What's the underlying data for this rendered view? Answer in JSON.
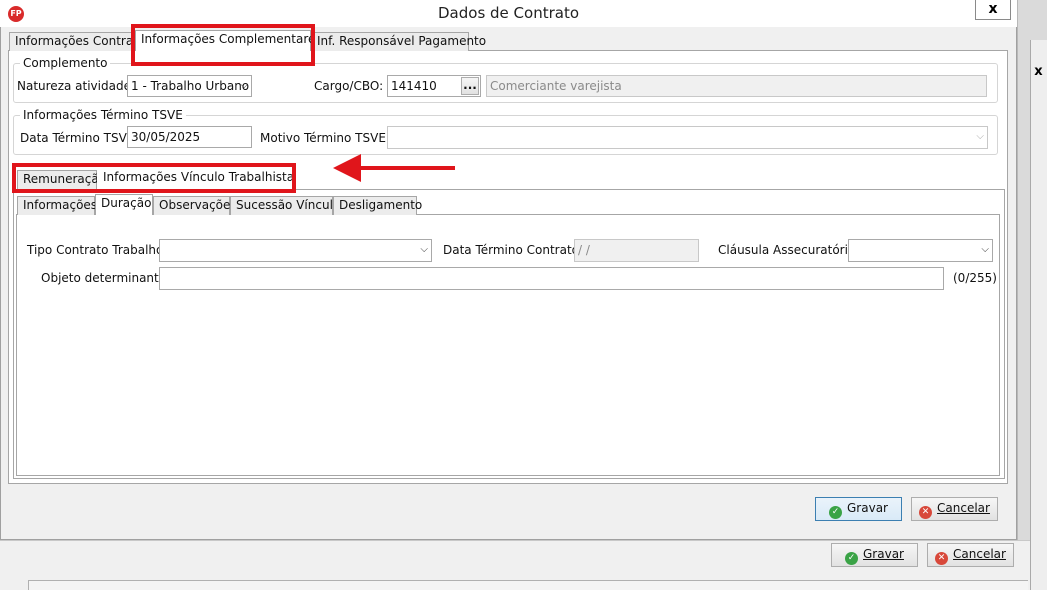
{
  "window": {
    "title": "Dados de Contrato",
    "app_icon": "FP",
    "close_glyph": "x"
  },
  "top_tabs": [
    "Informações Contrato",
    "Informações Complementares",
    "Inf. Responsável Pagamento"
  ],
  "complemento": {
    "title": "Complemento",
    "natureza_label": "Natureza atividade:",
    "natureza_value": "1 - Trabalho Urbano",
    "cargo_label": "Cargo/CBO:",
    "cargo_code": "141410",
    "cargo_lookup_glyph": "...",
    "cargo_desc": "Comerciante varejista"
  },
  "termino_tsve": {
    "title": "Informações Término TSVE",
    "data_label": "Data Término TSVE:",
    "data_value": "30/05/2025",
    "motivo_label": "Motivo Término TSVE:",
    "motivo_value": ""
  },
  "mid_tabs": [
    "Remuneração",
    "Informações Vínculo Trabalhista"
  ],
  "sub_tabs": [
    "Informações",
    "Duração",
    "Observações",
    "Sucessão Vínculo",
    "Desligamento"
  ],
  "duracao": {
    "tipo_label": "Tipo Contrato Trabalho:",
    "tipo_value": "",
    "data_termino_label": "Data Término Contrato:",
    "data_termino_value": " /  /",
    "clausula_label": "Cláusula Assecuratória:",
    "clausula_value": "",
    "objeto_label": "Objeto determinante:",
    "objeto_value": "",
    "objeto_counter": "(0/255)"
  },
  "dialog_buttons": {
    "save": "Gravar",
    "cancel": "Cancelar"
  },
  "parent_buttons": {
    "save": "Gravar",
    "cancel": "Cancelar",
    "close_glyph": "x"
  },
  "colors": {
    "annotation_red": "#e0151b",
    "ok_green": "#3aa346",
    "cancel_red": "#d8483a"
  }
}
